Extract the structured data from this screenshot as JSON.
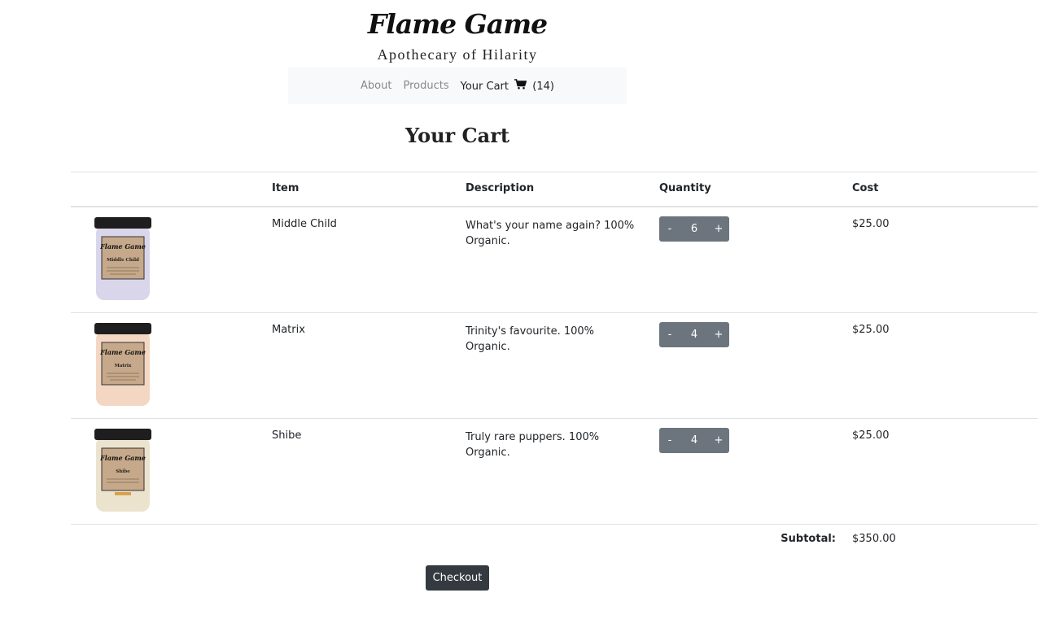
{
  "brand": {
    "title": "Flame Game",
    "tagline": "Apothecary of Hilarity"
  },
  "nav": {
    "about": "About",
    "products": "Products",
    "cart_label": "Your Cart",
    "cart_count": "(14)"
  },
  "page_title": "Your Cart",
  "table": {
    "headers": {
      "image": "",
      "item": "Item",
      "description": "Description",
      "quantity": "Quantity",
      "cost": "Cost"
    },
    "rows": [
      {
        "item": "Middle Child",
        "description": "What's your name again? 100% Organic.",
        "quantity": "6",
        "cost": "$25.00",
        "jar_name": "Middle Child",
        "jar_color": "#d9d6ec"
      },
      {
        "item": "Matrix",
        "description": "Trinity's favourite. 100% Organic.",
        "quantity": "4",
        "cost": "$25.00",
        "jar_name": "Matrix",
        "jar_color": "#f3d7c3"
      },
      {
        "item": "Shibe",
        "description": "Truly rare puppers. 100% Organic.",
        "quantity": "4",
        "cost": "$25.00",
        "jar_name": "Shibe",
        "jar_color": "#ece3cf"
      }
    ],
    "minus_label": "-",
    "plus_label": "+"
  },
  "subtotal": {
    "label": "Subtotal:",
    "value": "$350.00"
  },
  "checkout_label": "Checkout",
  "colors": {
    "qty_button": "#6c757d",
    "checkout_button": "#343a40",
    "navbar_bg": "#f8f9fa"
  }
}
